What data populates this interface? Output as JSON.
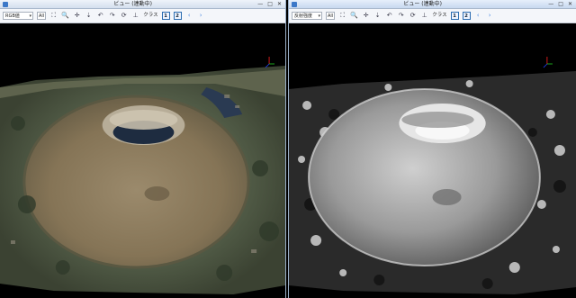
{
  "left": {
    "title": "ビュー (連動中)",
    "display_mode": "RGB値",
    "all_label": "All",
    "class_label": "クラス",
    "class_buttons": [
      "1",
      "2"
    ],
    "window_buttons": [
      "—",
      "□",
      "✕"
    ]
  },
  "right": {
    "title": "ビュー (連動中)",
    "display_mode": "反射強度",
    "all_label": "All",
    "class_label": "クラス",
    "class_buttons": [
      "1",
      "2"
    ],
    "window_buttons": [
      "—",
      "□",
      "✕"
    ]
  },
  "icons": {
    "fit": "⛶",
    "zoom": "🔍",
    "pan": "✛",
    "rotate_left": "↶",
    "rotate_right": "↷",
    "refresh": "⟳",
    "axes": "⊥",
    "back": "‹",
    "forward": "›"
  },
  "colors": {
    "accent": "#4a8ae0",
    "crater_floor": "#8a7a60",
    "rim_vegetation": "#4a5438",
    "lake": "#1e2c40"
  }
}
